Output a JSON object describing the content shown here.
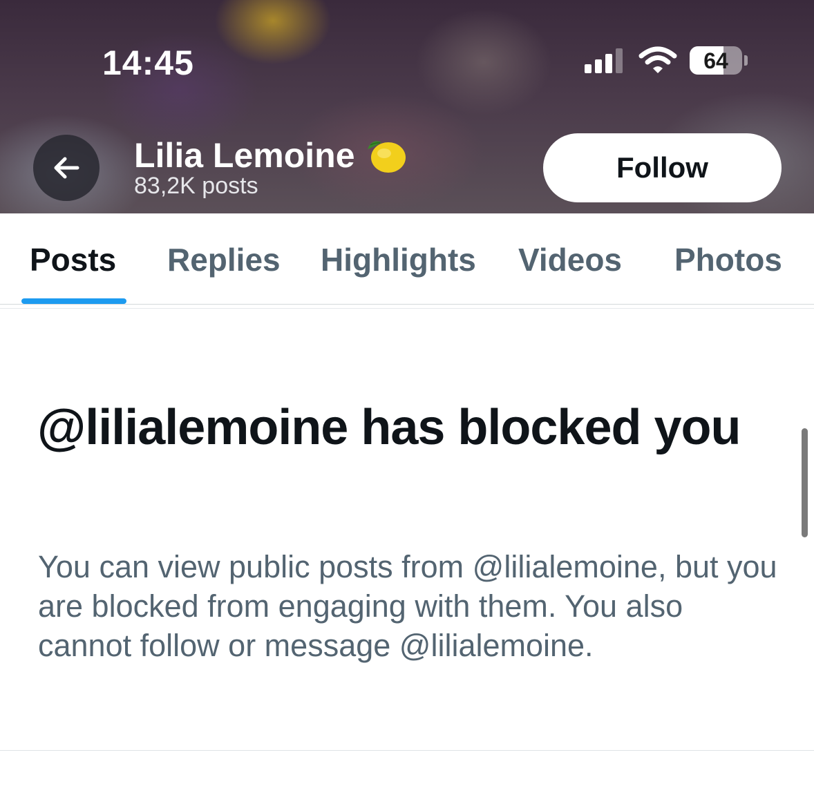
{
  "status_bar": {
    "time": "14:45",
    "battery_percent": "64",
    "signal_bars_active": 3,
    "icons": [
      "signal-icon",
      "wifi-icon",
      "battery-icon"
    ]
  },
  "header": {
    "back_icon": "arrow-left-icon",
    "name": "Lilia Lemoine",
    "name_emoji_icon": "lemon-icon",
    "posts_count": "83,2K posts",
    "follow_label": "Follow"
  },
  "tabs": [
    {
      "label": "Posts",
      "active": true
    },
    {
      "label": "Replies",
      "active": false
    },
    {
      "label": "Highlights",
      "active": false
    },
    {
      "label": "Videos",
      "active": false
    },
    {
      "label": "Photos",
      "active": false
    }
  ],
  "blocked": {
    "title": "@lilialemoine has blocked you",
    "description": "You can view public posts from @lilialemoine, but you are blocked from engaging with them. You also cannot follow or message @lilialemoine."
  },
  "colors": {
    "accent": "#1d9bf0",
    "primary_text": "#0f1419",
    "secondary_text": "#536471"
  }
}
